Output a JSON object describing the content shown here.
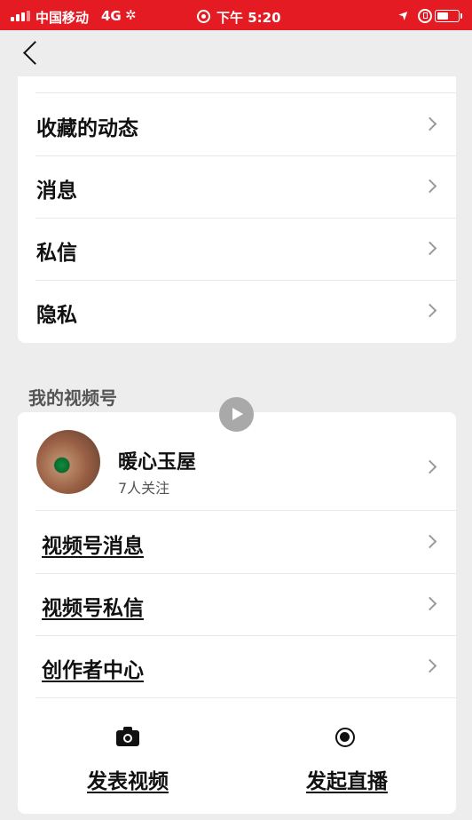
{
  "status_bar": {
    "carrier": "中国移动",
    "network": "4G",
    "loading_glyph": "✲",
    "time": "下午 5:20",
    "location_arrow": "➤",
    "icons": [
      "signal-icon",
      "alarm-icon",
      "location-icon",
      "orientation-lock-icon",
      "battery-icon"
    ]
  },
  "nav": {
    "back_icon": "chevron-left-icon"
  },
  "menu": {
    "items": [
      {
        "label": "收藏的动态"
      },
      {
        "label": "消息"
      },
      {
        "label": "私信"
      },
      {
        "label": "隐私"
      }
    ]
  },
  "channel": {
    "section_title": "我的视频号",
    "profile": {
      "name": "暖心玉屋",
      "followers": "7人关注"
    },
    "items": [
      {
        "label": "视频号消息"
      },
      {
        "label": "视频号私信"
      },
      {
        "label": "创作者中心"
      }
    ],
    "actions": [
      {
        "label": "发表视频",
        "icon": "camera-icon"
      },
      {
        "label": "发起直播",
        "icon": "record-icon"
      }
    ]
  },
  "colors": {
    "status_bar": "#e51b24",
    "background": "#ededed",
    "card": "#ffffff",
    "chevron": "#9a9a9a"
  }
}
